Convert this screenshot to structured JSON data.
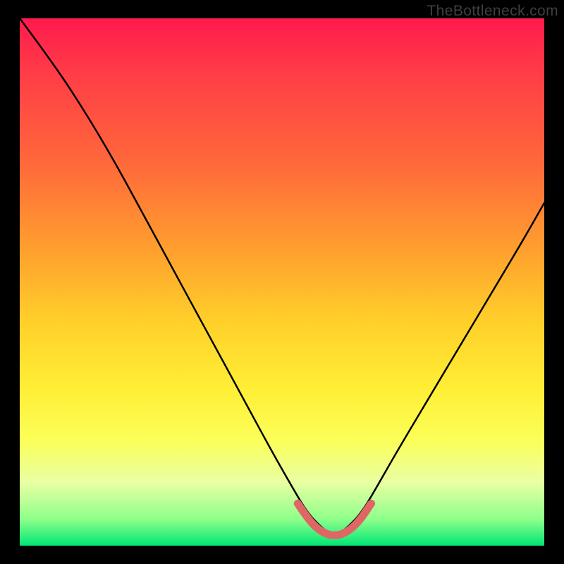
{
  "watermark": "TheBottleneck.com",
  "chart_data": {
    "type": "line",
    "title": "",
    "xlabel": "",
    "ylabel": "",
    "xlim": [
      0,
      100
    ],
    "ylim": [
      0,
      100
    ],
    "series": [
      {
        "name": "bottleneck-curve",
        "x": [
          0,
          6,
          12,
          18,
          24,
          30,
          36,
          42,
          48,
          52,
          55,
          58,
          60,
          62,
          65,
          68,
          72,
          78,
          84,
          90,
          96,
          100
        ],
        "values": [
          100,
          92,
          83,
          73,
          62,
          51,
          40,
          29,
          18,
          11,
          6,
          3,
          2,
          3,
          6,
          11,
          18,
          28,
          38,
          48,
          58,
          65
        ]
      }
    ],
    "highlight": {
      "name": "sweet-spot",
      "x": [
        53,
        55,
        57,
        59,
        60,
        61,
        63,
        65,
        67
      ],
      "values": [
        8,
        5,
        3,
        2,
        2,
        2,
        3,
        5,
        8
      ]
    },
    "colors": {
      "top": "#ff1a4d",
      "mid": "#ffd12a",
      "bottom": "#00e676",
      "curve": "#000000",
      "highlight": "#e06666"
    }
  }
}
